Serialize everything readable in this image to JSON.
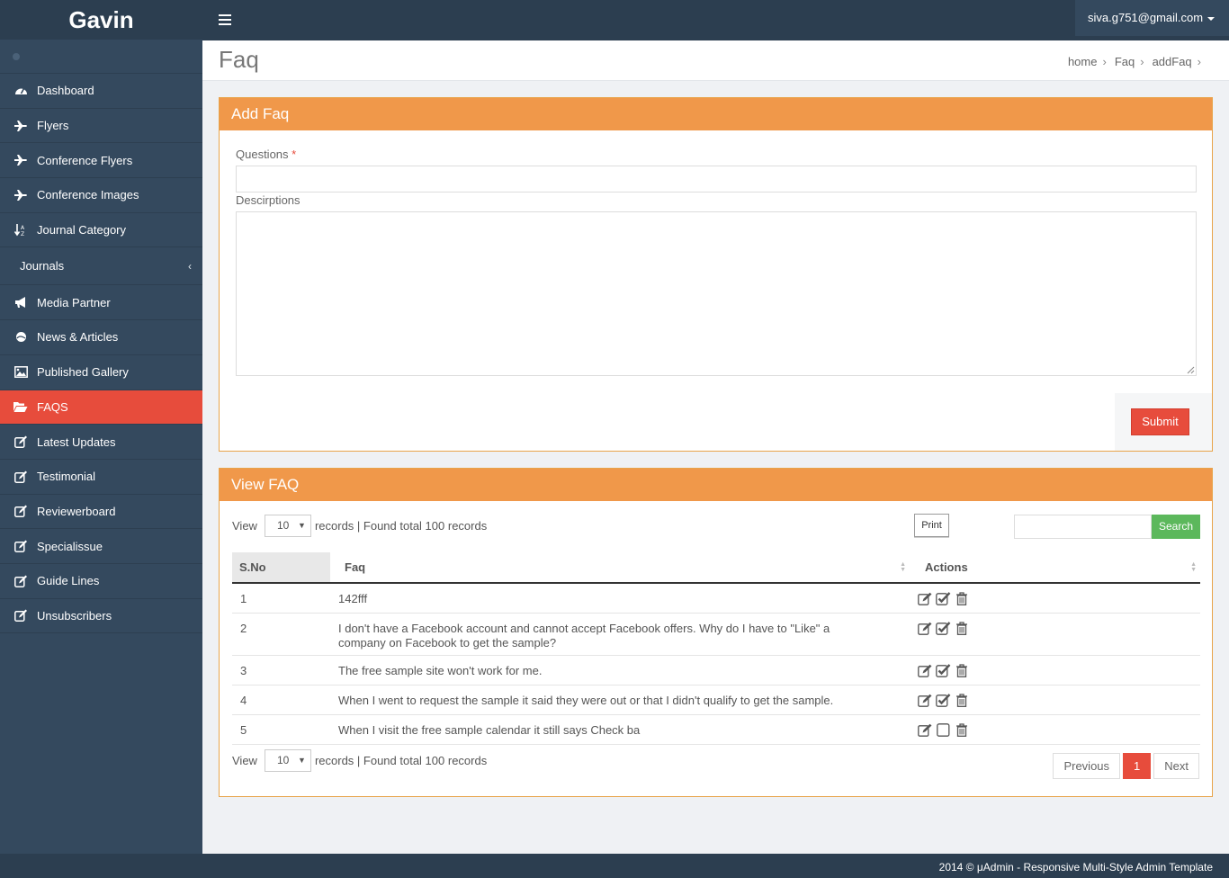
{
  "brand": "Gavin",
  "user": {
    "email": "siva.g751@gmail.com"
  },
  "sidebar": {
    "items": [
      {
        "label": "Dashboard",
        "icon": "dashboard-icon"
      },
      {
        "label": "Flyers",
        "icon": "plane-icon"
      },
      {
        "label": "Conference Flyers",
        "icon": "plane-icon"
      },
      {
        "label": "Conference Images",
        "icon": "plane-icon"
      },
      {
        "label": "Journal Category",
        "icon": "sort-alpha-icon"
      },
      {
        "label": "Journals",
        "icon": ""
      },
      {
        "label": "Media Partner",
        "icon": "bullhorn-icon"
      },
      {
        "label": "News & Articles",
        "icon": "globe-icon"
      },
      {
        "label": "Published Gallery",
        "icon": "picture-icon"
      },
      {
        "label": "FAQS",
        "icon": "folder-open-icon",
        "active": true
      },
      {
        "label": "Latest Updates",
        "icon": "edit-icon"
      },
      {
        "label": "Testimonial",
        "icon": "edit-icon"
      },
      {
        "label": "Reviewerboard",
        "icon": "edit-icon"
      },
      {
        "label": "Specialissue",
        "icon": "edit-icon"
      },
      {
        "label": "Guide Lines",
        "icon": "edit-icon"
      },
      {
        "label": "Unsubscribers",
        "icon": "edit-icon"
      }
    ]
  },
  "page": {
    "title": "Faq",
    "breadcrumb": [
      "home",
      "Faq",
      "addFaq"
    ]
  },
  "add_panel": {
    "title": "Add Faq",
    "questions_label": "Questions",
    "required_mark": "*",
    "descriptions_label": "Descirptions",
    "submit_label": "Submit"
  },
  "view_panel": {
    "title": "View FAQ",
    "view_label": "View",
    "page_size": "10",
    "records_text": "records | Found total 100 records",
    "print_label": "Print",
    "search_label": "Search",
    "columns": {
      "sno": "S.No",
      "faq": "Faq",
      "actions": "Actions"
    },
    "rows": [
      {
        "sno": "1",
        "faq": "142fff",
        "approved": true
      },
      {
        "sno": "2",
        "faq": "I don't have a Facebook account and cannot accept Facebook offers. Why do I have to \"Like\" a company on Facebook to get the sample?",
        "approved": true
      },
      {
        "sno": "3",
        "faq": "The free sample site won't work for me.",
        "approved": true
      },
      {
        "sno": "4",
        "faq": "When I went to request the sample it said they were out or that I didn't qualify to get the sample.",
        "approved": true
      },
      {
        "sno": "5",
        "faq": "When I visit the free sample calendar it still says Check ba",
        "approved": false
      }
    ],
    "pagination": {
      "previous": "Previous",
      "current": "1",
      "next": "Next"
    }
  },
  "footer": "2014 © μAdmin - Responsive Multi-Style Admin Template"
}
